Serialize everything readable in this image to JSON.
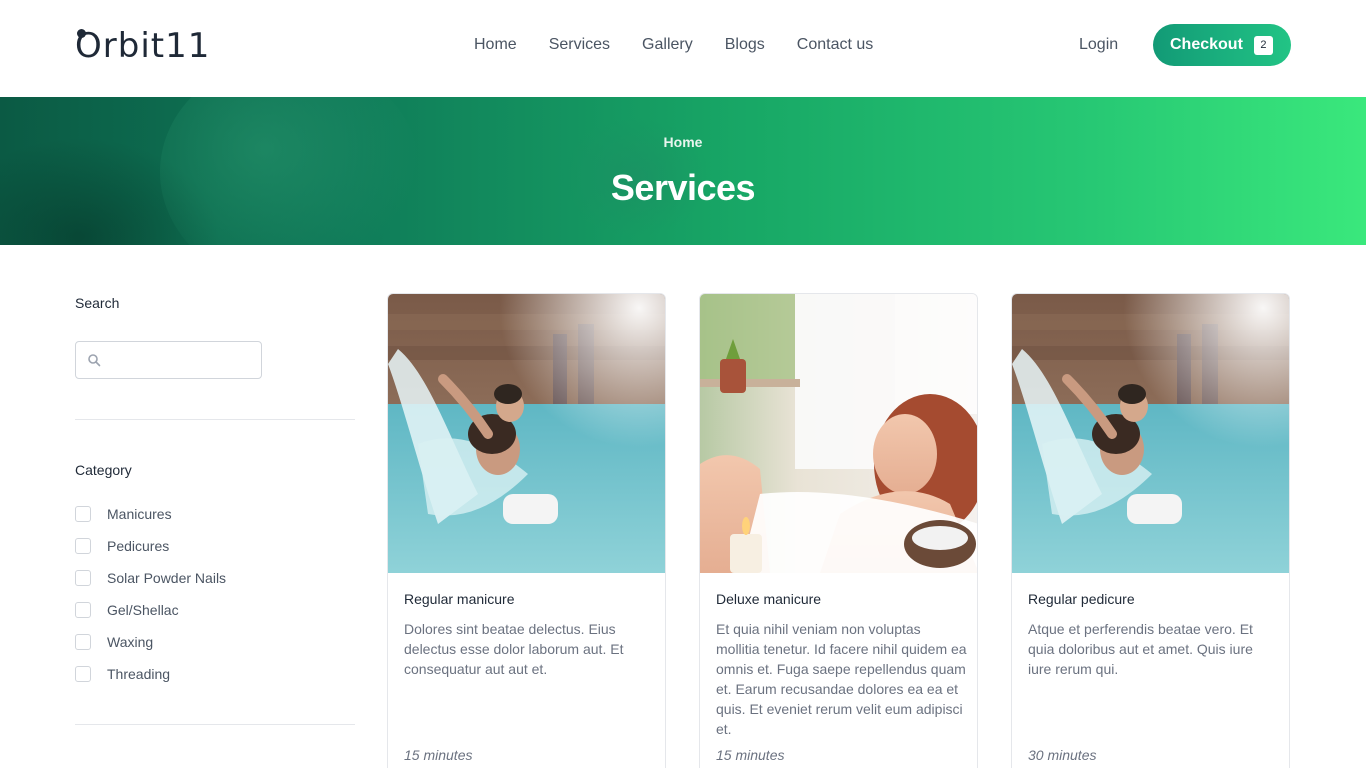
{
  "header": {
    "logo_text": "Orbit11",
    "nav": [
      "Home",
      "Services",
      "Gallery",
      "Blogs",
      "Contact us"
    ],
    "login_label": "Login",
    "checkout_label": "Checkout",
    "cart_count": "2"
  },
  "hero": {
    "breadcrumb": "Home",
    "title": "Services"
  },
  "sidebar": {
    "search_label": "Search",
    "search_placeholder": "",
    "category_label": "Category",
    "categories": [
      "Manicures",
      "Pedicures",
      "Solar Powder Nails",
      "Gel/Shellac",
      "Waxing",
      "Threading"
    ]
  },
  "services": [
    {
      "title": "Regular manicure",
      "description": "Dolores sint beatae delectus. Eius delectus esse dolor laborum aut. Et consequatur aut aut et.",
      "duration": "15 minutes",
      "image": "pool-waterfall-couple"
    },
    {
      "title": "Deluxe manicure",
      "description": "Et quia nihil veniam non voluptas mollitia tenetur. Id facere nihil quidem ea omnis et. Fuga saepe repellendus quam et. Earum recusandae dolores ea ea et quis. Et eveniet rerum velit eum adipisci et.",
      "duration": "15 minutes",
      "image": "woman-bubble-bath"
    },
    {
      "title": "Regular pedicure",
      "description": "Atque et perferendis beatae vero. Et quia doloribus aut et amet. Quis iure iure rerum qui.",
      "duration": "30 minutes",
      "image": "pool-waterfall-couple"
    }
  ],
  "colors": {
    "accent": "#1aa97a",
    "hero_start": "#0b5a44",
    "hero_end": "#3ae87c"
  }
}
